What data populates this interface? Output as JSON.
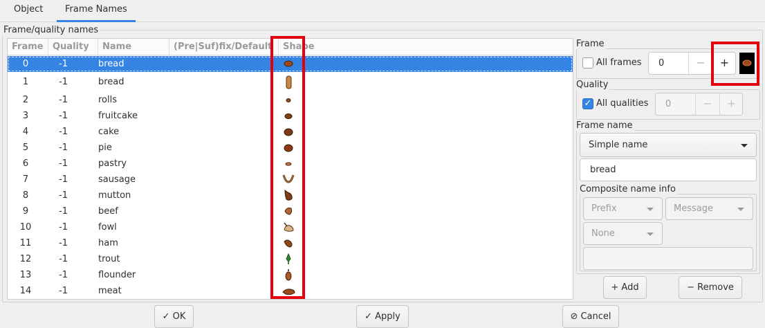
{
  "tabs": [
    {
      "label": "Object",
      "active": false
    },
    {
      "label": "Frame Names",
      "active": true
    }
  ],
  "frame_quality_group": {
    "label": "Frame/quality names"
  },
  "table": {
    "columns": [
      "Frame",
      "Quality",
      "Name",
      "(Pre|Suf)fix/Default",
      "Shape"
    ],
    "rows": [
      {
        "frame": "0",
        "quality": "-1",
        "name": "bread",
        "shape": "bread-loaf-icon",
        "selected": true
      },
      {
        "frame": "1",
        "quality": "-1",
        "name": "bread",
        "shape": "bread-long-icon"
      },
      {
        "frame": "2",
        "quality": "-1",
        "name": "rolls",
        "shape": "rolls-icon"
      },
      {
        "frame": "3",
        "quality": "-1",
        "name": "fruitcake",
        "shape": "fruitcake-icon"
      },
      {
        "frame": "4",
        "quality": "-1",
        "name": "cake",
        "shape": "cake-icon"
      },
      {
        "frame": "5",
        "quality": "-1",
        "name": "pie",
        "shape": "pie-icon"
      },
      {
        "frame": "6",
        "quality": "-1",
        "name": "pastry",
        "shape": "pastry-icon"
      },
      {
        "frame": "7",
        "quality": "-1",
        "name": "sausage",
        "shape": "sausage-icon"
      },
      {
        "frame": "8",
        "quality": "-1",
        "name": "mutton",
        "shape": "mutton-icon"
      },
      {
        "frame": "9",
        "quality": "-1",
        "name": "beef",
        "shape": "beef-icon"
      },
      {
        "frame": "10",
        "quality": "-1",
        "name": "fowl",
        "shape": "fowl-icon"
      },
      {
        "frame": "11",
        "quality": "-1",
        "name": "ham",
        "shape": "ham-icon"
      },
      {
        "frame": "12",
        "quality": "-1",
        "name": "trout",
        "shape": "trout-icon"
      },
      {
        "frame": "13",
        "quality": "-1",
        "name": "flounder",
        "shape": "flounder-icon"
      },
      {
        "frame": "14",
        "quality": "-1",
        "name": "meat",
        "shape": "meat-icon"
      }
    ]
  },
  "frame_panel": {
    "label": "Frame",
    "all_frames_label": "All frames",
    "all_frames_checked": false,
    "value": "0",
    "minus": "−",
    "plus": "+",
    "preview_icon": "bread-preview-icon"
  },
  "quality_panel": {
    "label": "Quality",
    "all_qualities_label": "All qualities",
    "all_qualities_checked": true,
    "value": "0",
    "minus": "−",
    "plus": "+"
  },
  "frame_name_panel": {
    "label": "Frame name",
    "type_selected": "Simple name",
    "name_value": "bread",
    "composite_label": "Composite name info",
    "prefix": "Prefix",
    "message": "Message",
    "none": "None",
    "composite_text": ""
  },
  "list_buttons": {
    "add": "+ Add",
    "remove": "− Remove"
  },
  "footer": {
    "ok": "✓ OK",
    "apply": "✓ Apply",
    "cancel": "⊘ Cancel"
  },
  "colors": {
    "accent": "#3584e4",
    "highlight": "#e3000f",
    "food_brown": "#8a4a1c"
  }
}
